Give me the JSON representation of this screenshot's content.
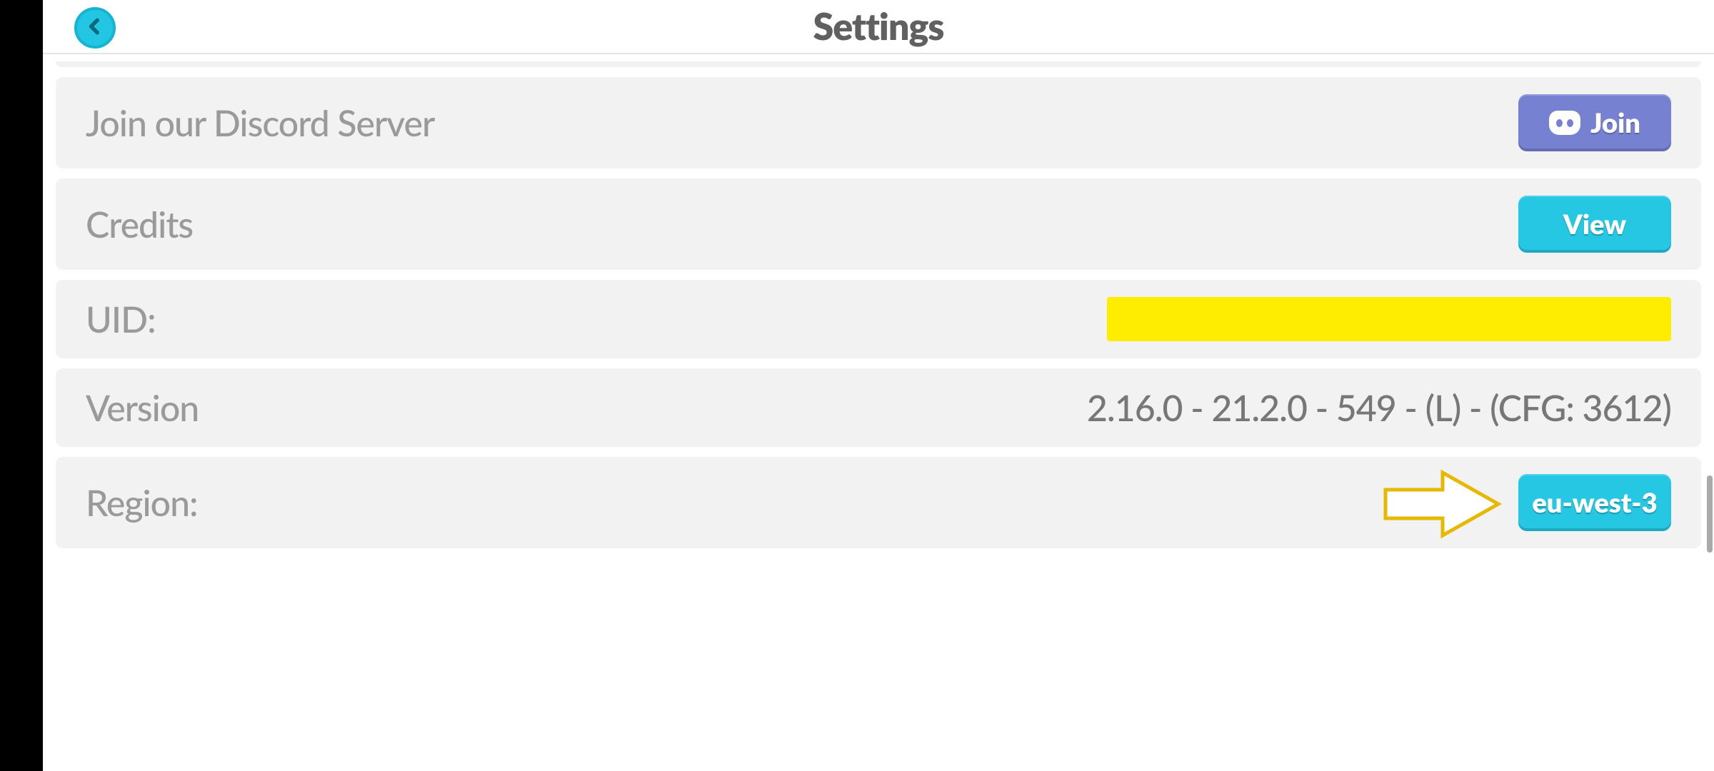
{
  "header": {
    "title": "Settings"
  },
  "rows": {
    "discord": {
      "label": "Join our Discord Server",
      "button": "Join"
    },
    "credits": {
      "label": "Credits",
      "button": "View"
    },
    "uid": {
      "label": "UID:"
    },
    "version": {
      "label": "Version",
      "value": "2.16.0 - 21.2.0 - 549 - (L) - (CFG: 3612)"
    },
    "region": {
      "label": "Region:",
      "button": "eu-west-3"
    }
  },
  "colors": {
    "accent_cyan": "#25c7e3",
    "discord": "#7681d2",
    "highlight": "#ffed00",
    "annotation": "#e6b800"
  }
}
